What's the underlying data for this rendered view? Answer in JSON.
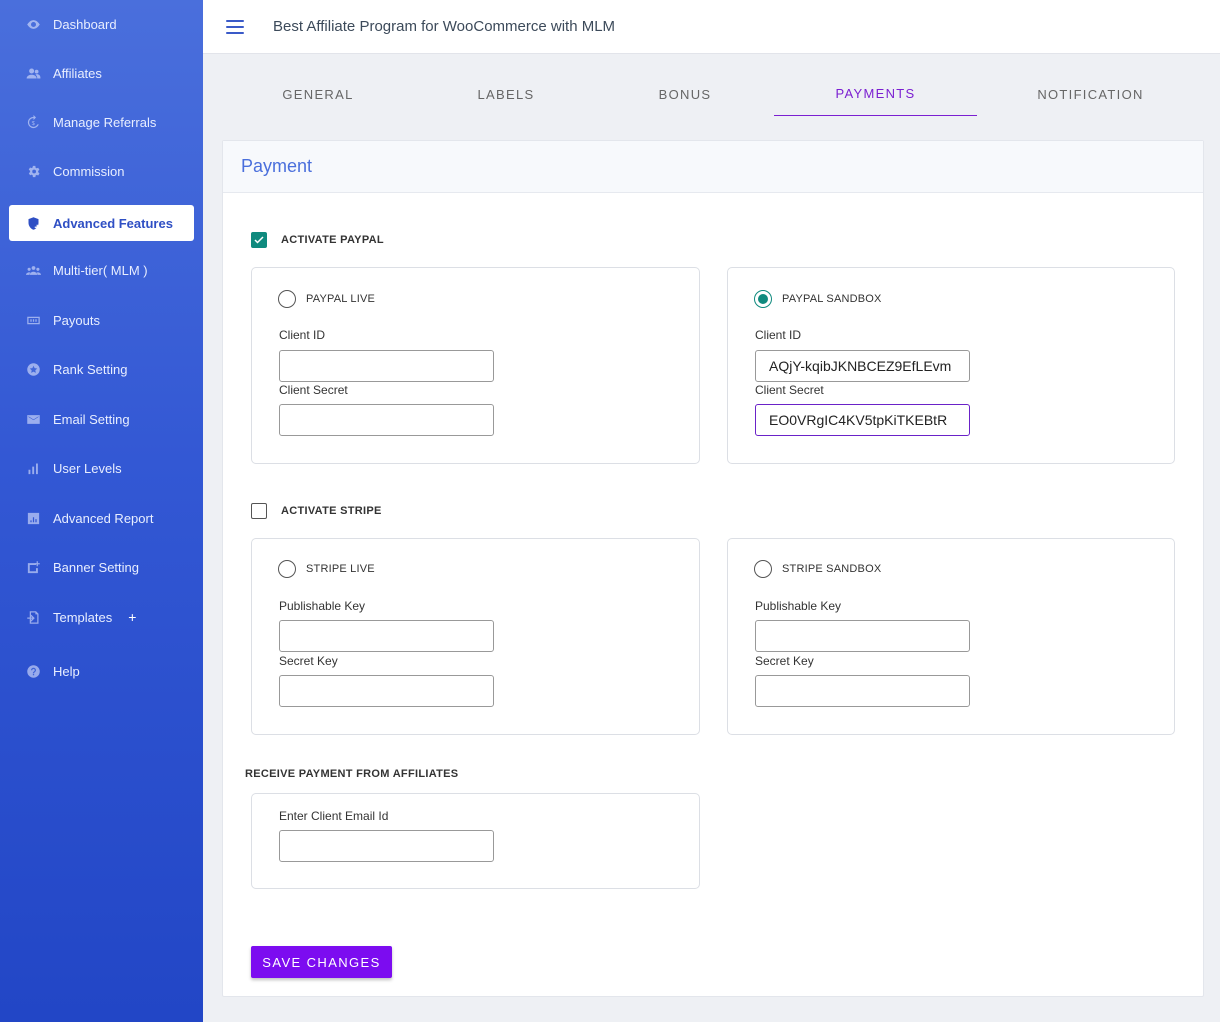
{
  "app": {
    "title": "Best Affiliate Program for WooCommerce with MLM"
  },
  "sidebar": {
    "items": [
      {
        "label": "Dashboard",
        "icon": "eye-icon"
      },
      {
        "label": "Affiliates",
        "icon": "users-icon"
      },
      {
        "label": "Manage Referrals",
        "icon": "refresh-dollar-icon"
      },
      {
        "label": "Commission",
        "icon": "gear-icon"
      },
      {
        "label": "Advanced Features",
        "icon": "shield-plus-icon",
        "active": true
      },
      {
        "label": "Multi-tier( MLM )",
        "icon": "group-icon"
      },
      {
        "label": "Payouts",
        "icon": "money-icon"
      },
      {
        "label": "Rank Setting",
        "icon": "star-badge-icon"
      },
      {
        "label": "Email Setting",
        "icon": "envelope-icon"
      },
      {
        "label": "User Levels",
        "icon": "bar-chart-icon"
      },
      {
        "label": "Advanced Report",
        "icon": "report-icon"
      },
      {
        "label": "Banner Setting",
        "icon": "banner-icon"
      },
      {
        "label": "Templates",
        "icon": "template-icon",
        "expand": "+"
      },
      {
        "label": "Help",
        "icon": "help-icon"
      }
    ]
  },
  "tabs": [
    {
      "label": "GENERAL"
    },
    {
      "label": "LABELS"
    },
    {
      "label": "BONUS"
    },
    {
      "label": "PAYMENTS",
      "active": true
    },
    {
      "label": "NOTIFICATION"
    }
  ],
  "payment": {
    "title": "Payment",
    "paypal": {
      "activate_label": "ACTIVATE PAYPAL",
      "activated": true,
      "live": {
        "label": "PAYPAL LIVE",
        "selected": false,
        "client_id_label": "Client ID",
        "client_id_value": "",
        "client_secret_label": "Client Secret",
        "client_secret_value": ""
      },
      "sandbox": {
        "label": "PAYPAL SANDBOX",
        "selected": true,
        "client_id_label": "Client ID",
        "client_id_value": "AQjY-kqibJKNBCEZ9EfLEvm",
        "client_secret_label": "Client Secret",
        "client_secret_value": "EO0VRgIC4KV5tpKiTKEBtR"
      }
    },
    "stripe": {
      "activate_label": "ACTIVATE STRIPE",
      "activated": false,
      "live": {
        "label": "STRIPE LIVE",
        "selected": false,
        "publishable_label": "Publishable Key",
        "publishable_value": "",
        "secret_label": "Secret Key",
        "secret_value": ""
      },
      "sandbox": {
        "label": "STRIPE SANDBOX",
        "selected": false,
        "publishable_label": "Publishable Key",
        "publishable_value": "",
        "secret_label": "Secret Key",
        "secret_value": ""
      }
    },
    "receive": {
      "title": "RECEIVE PAYMENT FROM AFFILIATES",
      "email_label": "Enter Client Email Id",
      "email_value": ""
    },
    "save_label": "SAVE CHANGES"
  },
  "colors": {
    "accent": "#7c0cf0",
    "check": "#0f8a7e",
    "sidebar": "#3358d4",
    "link": "#4a6fdc"
  }
}
